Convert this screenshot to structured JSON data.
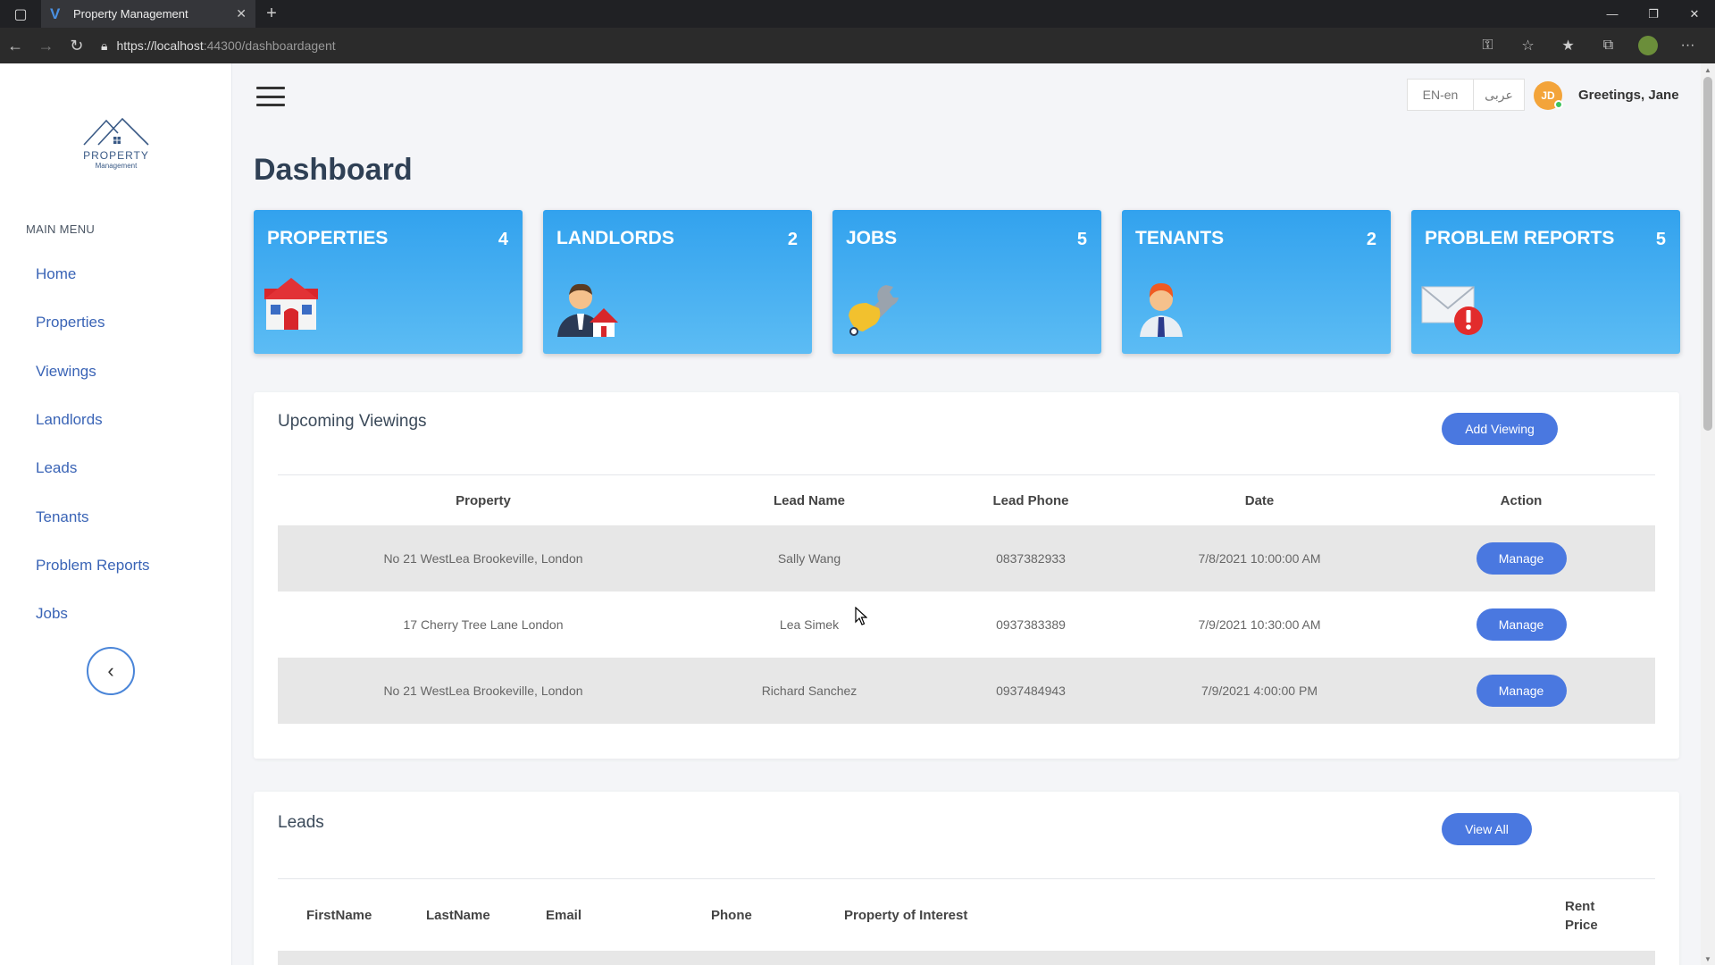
{
  "browser": {
    "tab_title": "Property Management",
    "url_scheme_host": "https://localhost",
    "url_rest": ":44300/dashboardagent"
  },
  "sidebar": {
    "logo_line1": "PROPERTY",
    "logo_line2": "Management",
    "menu_title": "MAIN MENU",
    "items": [
      {
        "label": "Home"
      },
      {
        "label": "Properties"
      },
      {
        "label": "Viewings"
      },
      {
        "label": "Landlords"
      },
      {
        "label": "Leads"
      },
      {
        "label": "Tenants"
      },
      {
        "label": "Problem Reports"
      },
      {
        "label": "Jobs"
      }
    ]
  },
  "header": {
    "lang_en": "EN-en",
    "lang_ar": "عربى",
    "avatar_initials": "JD",
    "greeting": "Greetings, Jane"
  },
  "page_title": "Dashboard",
  "stats": [
    {
      "label": "PROPERTIES",
      "count": "4",
      "icon": "house-icon"
    },
    {
      "label": "LANDLORDS",
      "count": "2",
      "icon": "landlord-icon"
    },
    {
      "label": "JOBS",
      "count": "5",
      "icon": "wrench-icon"
    },
    {
      "label": "TENANTS",
      "count": "2",
      "icon": "tenant-icon"
    },
    {
      "label": "PROBLEM REPORTS",
      "count": "5",
      "icon": "mail-alert-icon"
    }
  ],
  "viewings": {
    "title": "Upcoming Viewings",
    "add_button": "Add Viewing",
    "columns": [
      "Property",
      "Lead Name",
      "Lead Phone",
      "Date",
      "Action"
    ],
    "rows": [
      {
        "property": "No 21 WestLea Brookeville, London",
        "lead": "Sally Wang",
        "phone": "0837382933",
        "date": "7/8/2021 10:00:00 AM",
        "action": "Manage"
      },
      {
        "property": "17 Cherry Tree Lane London",
        "lead": "Lea Simek",
        "phone": "0937383389",
        "date": "7/9/2021 10:30:00 AM",
        "action": "Manage"
      },
      {
        "property": "No 21 WestLea Brookeville, London",
        "lead": "Richard Sanchez",
        "phone": "0937484943",
        "date": "7/9/2021 4:00:00 PM",
        "action": "Manage"
      }
    ]
  },
  "leads": {
    "title": "Leads",
    "view_all_button": "View All",
    "columns": [
      "FirstName",
      "LastName",
      "Email",
      "Phone",
      "Property of Interest",
      "Rent",
      "Price"
    ]
  },
  "colors": {
    "card_gradient_top": "#32a2ee",
    "card_gradient_bottom": "#5cbcf4",
    "button_blue": "#4a78e0",
    "sidebar_link": "#3a64b6"
  }
}
